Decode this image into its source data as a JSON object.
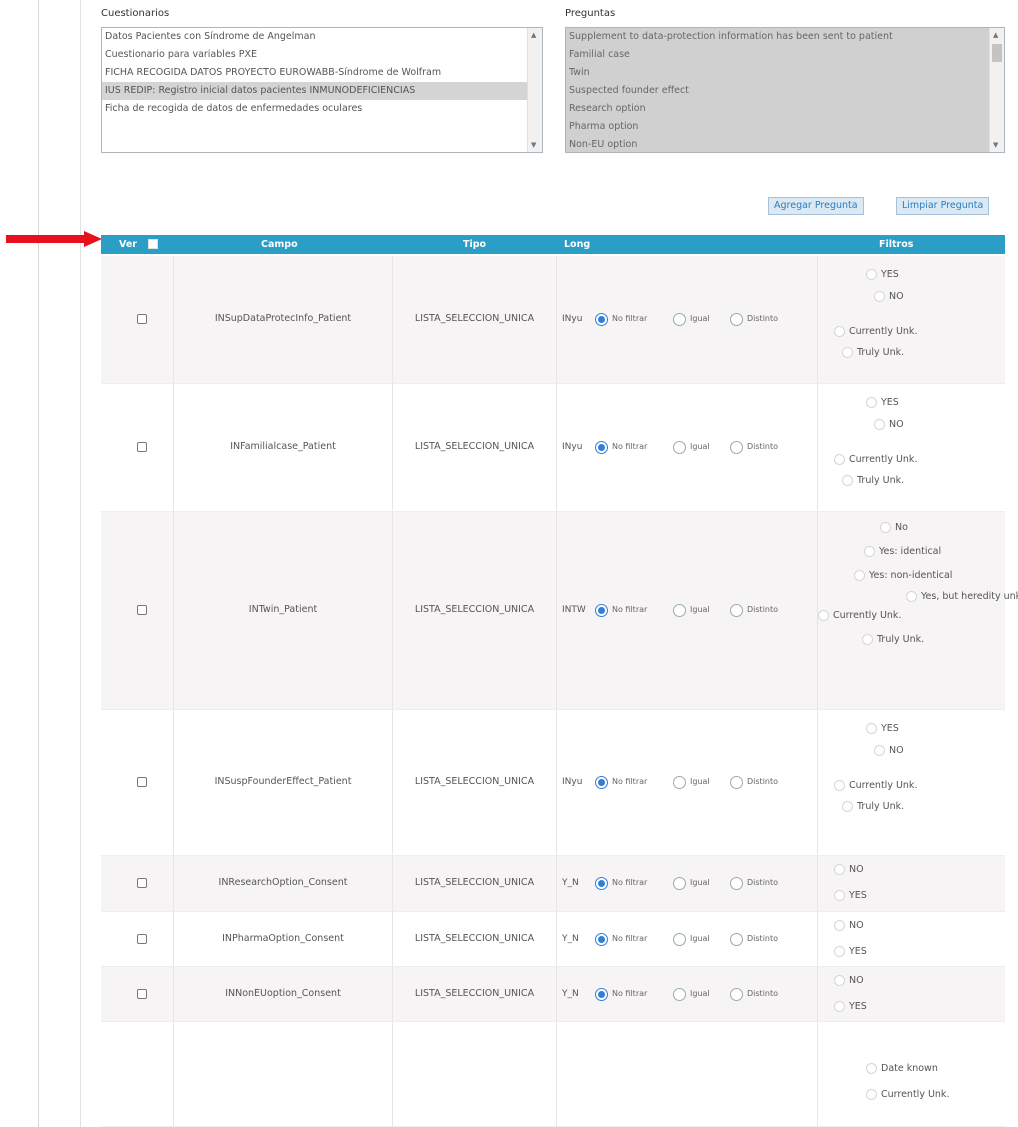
{
  "sections": {
    "questionnaires_label": "Cuestionarios",
    "questions_label": "Preguntas"
  },
  "questionnaires": [
    {
      "label": "Datos Pacientes con Síndrome de Angelman",
      "selected": false
    },
    {
      "label": "Cuestionario para variables PXE",
      "selected": false
    },
    {
      "label": "FICHA RECOGIDA DATOS PROYECTO EUROWABB-Síndrome de Wolfram",
      "selected": false
    },
    {
      "label": "IUS REDIP: Registro inicial datos pacientes INMUNODEFICIENCIAS",
      "selected": true
    },
    {
      "label": "Ficha de recogida de datos de enfermedades oculares",
      "selected": false
    }
  ],
  "questions": [
    "Supplement to data-protection information has been sent to patient",
    "Familial case",
    "Twin",
    "Suspected founder effect",
    "Research option",
    "Pharma option",
    "Non-EU option"
  ],
  "buttons": {
    "add_question": "Agregar Pregunta",
    "clear_question": "Limpiar Pregunta"
  },
  "table": {
    "headers": {
      "ver": "Ver",
      "campo": "Campo",
      "tipo": "Tipo",
      "long": "Long",
      "filtros": "Filtros"
    },
    "filter_labels": {
      "no_filter": "No filtrar",
      "equal": "Igual",
      "different": "Distinto"
    },
    "rows": [
      {
        "campo": "INSupDataProtecInfo_Patient",
        "tipo": "LISTA_SELECCION_UNICA",
        "long": "INyu",
        "options": [
          "YES",
          "NO",
          "Currently Unk.",
          "Truly Unk."
        ]
      },
      {
        "campo": "INFamilialcase_Patient",
        "tipo": "LISTA_SELECCION_UNICA",
        "long": "INyu",
        "options": [
          "YES",
          "NO",
          "Currently Unk.",
          "Truly Unk."
        ]
      },
      {
        "campo": "INTwin_Patient",
        "tipo": "LISTA_SELECCION_UNICA",
        "long": "INTW",
        "options": [
          "No",
          "Yes: identical",
          "Yes: non-identical",
          "Yes, but heredity unknown",
          "Currently Unk.",
          "Truly Unk."
        ]
      },
      {
        "campo": "INSuspFounderEffect_Patient",
        "tipo": "LISTA_SELECCION_UNICA",
        "long": "INyu",
        "options": [
          "YES",
          "NO",
          "Currently Unk.",
          "Truly Unk."
        ]
      },
      {
        "campo": "INResearchOption_Consent",
        "tipo": "LISTA_SELECCION_UNICA",
        "long": "Y_N",
        "options": [
          "NO",
          "YES"
        ]
      },
      {
        "campo": "INPharmaOption_Consent",
        "tipo": "LISTA_SELECCION_UNICA",
        "long": "Y_N",
        "options": [
          "NO",
          "YES"
        ]
      },
      {
        "campo": "INNonEUoption_Consent",
        "tipo": "LISTA_SELECCION_UNICA",
        "long": "Y_N",
        "options": [
          "NO",
          "YES"
        ]
      },
      {
        "campo": "",
        "tipo": "",
        "long": "",
        "options": [
          "Date known",
          "Currently Unk."
        ]
      }
    ]
  },
  "colors": {
    "header_bg": "#2b9ec5",
    "arrow": "#e8101c",
    "radio_selected": "#2f7fd6"
  }
}
